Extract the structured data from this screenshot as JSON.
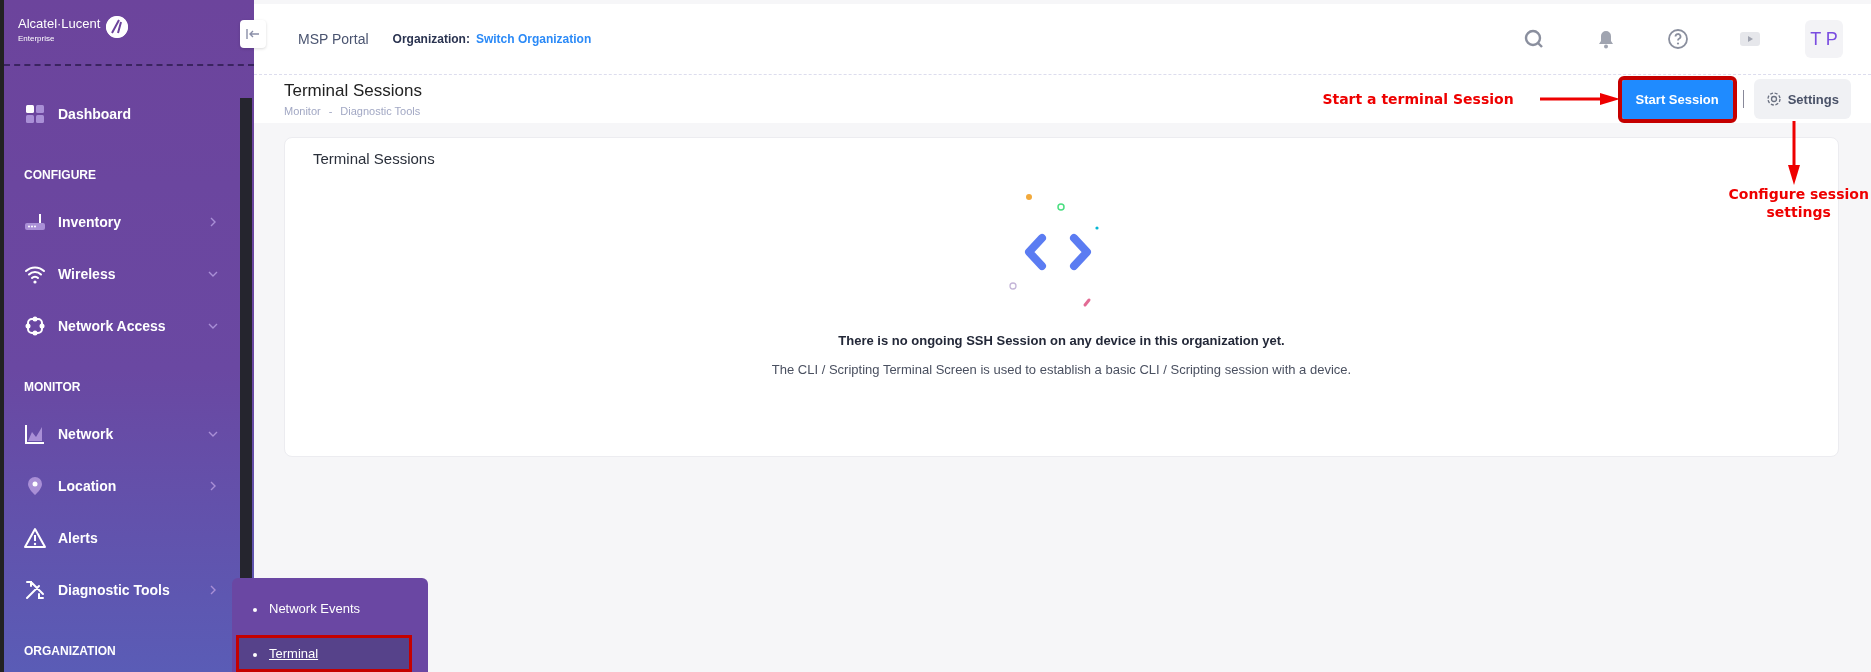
{
  "sidebar": {
    "logo": {
      "brand": "Alcatel·Lucent",
      "sub": "Enterprise"
    },
    "items": [
      {
        "kind": "link",
        "label": "Dashboard"
      },
      {
        "kind": "section",
        "label": "CONFIGURE"
      },
      {
        "kind": "link",
        "label": "Inventory",
        "expanded": false
      },
      {
        "kind": "link",
        "label": "Wireless",
        "expanded": true
      },
      {
        "kind": "link",
        "label": "Network Access",
        "expanded": true
      },
      {
        "kind": "section",
        "label": "MONITOR"
      },
      {
        "kind": "link",
        "label": "Network",
        "expanded": true
      },
      {
        "kind": "link",
        "label": "Location",
        "expanded": false
      },
      {
        "kind": "link",
        "label": "Alerts"
      },
      {
        "kind": "link",
        "label": "Diagnostic Tools",
        "expanded": false
      },
      {
        "kind": "section",
        "label": "ORGANIZATION"
      }
    ],
    "flyout": [
      {
        "label": "Network Events",
        "selected": false,
        "highlighted": false
      },
      {
        "label": "Terminal",
        "selected": true,
        "highlighted": true
      }
    ]
  },
  "top_bar": {
    "portal": "MSP Portal",
    "org_label": "Organization:",
    "org_link": "Switch Organization",
    "avatar": "T P"
  },
  "page_header": {
    "title": "Terminal Sessions",
    "breadcrumb": [
      "Monitor",
      "Diagnostic Tools"
    ],
    "separator": "-",
    "start_button": {
      "label": "Start Session",
      "highlighted": true
    },
    "settings_button": {
      "label": "Settings"
    }
  },
  "annotations": [
    {
      "kind": "left",
      "text": "Start a terminal Session"
    },
    {
      "kind": "below",
      "text": "Configure session settings"
    }
  ],
  "card": {
    "title": "Terminal Sessions",
    "message": "There is no ongoing SSH Session on any device in this organization yet.",
    "description": "The CLI / Scripting Terminal Screen is used to establish a basic CLI / Scripting session with a device."
  }
}
